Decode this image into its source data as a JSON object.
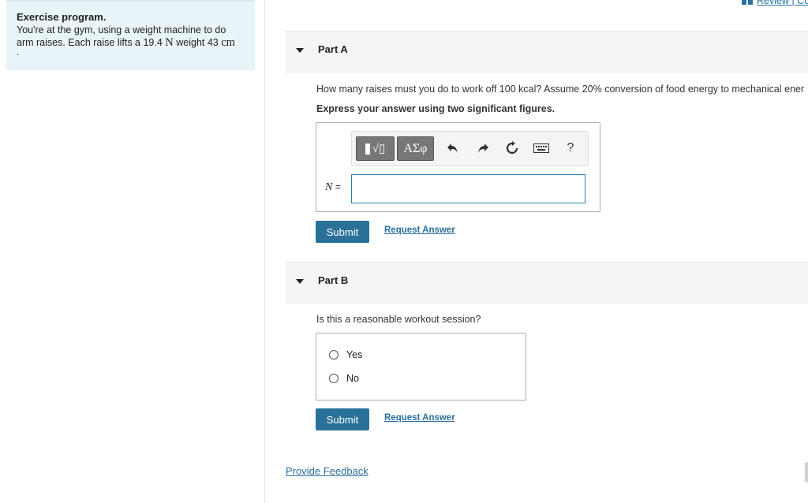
{
  "problem": {
    "title": "Exercise program.",
    "line1": "You're at the gym, using a weight machine to do",
    "line2_prefix": "arm raises. Each raise lifts a 19.4",
    "line2_unit_n": "N",
    "line2_mid": "weight 43",
    "line2_unit_cm": "cm",
    "line3": "."
  },
  "top_link": {
    "text": "Review | Co"
  },
  "part_a": {
    "label": "Part A",
    "question": "How many raises must you do to work off 100 kcal? Assume 20% conversion of food energy to mechanical ener",
    "instruction": "Express your answer using two significant figures.",
    "toolbar": {
      "templates_label": "√▯",
      "greek_label": "ΑΣφ",
      "help_label": "?"
    },
    "answer_var": "N",
    "answer_eq": "=",
    "answer_value": "",
    "submit_label": "Submit",
    "request_label": "Request Answer"
  },
  "part_b": {
    "label": "Part B",
    "question": "Is this a reasonable workout session?",
    "options": [
      "Yes",
      "No"
    ],
    "submit_label": "Submit",
    "request_label": "Request Answer"
  },
  "feedback_label": "Provide Feedback"
}
